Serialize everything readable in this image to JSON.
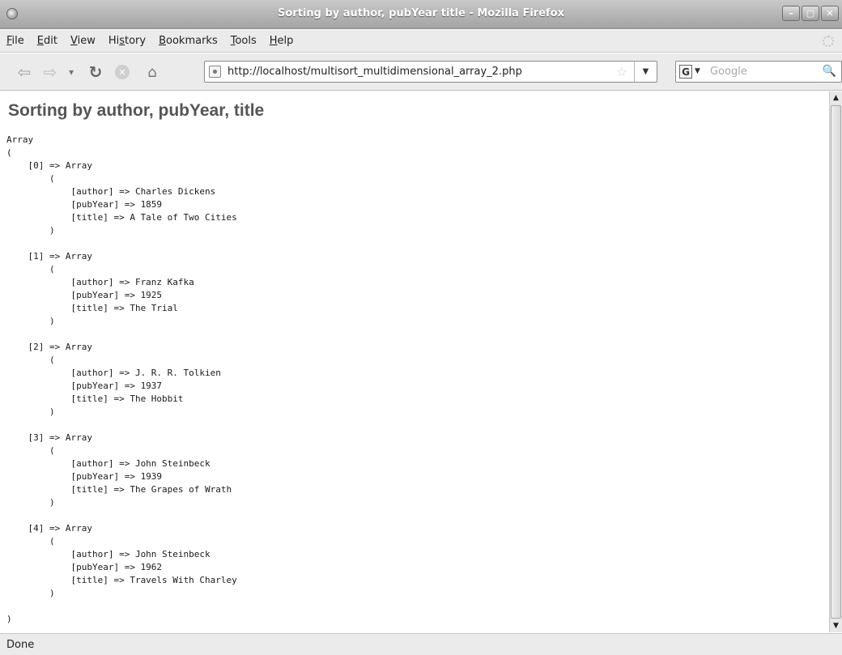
{
  "window": {
    "title": "Sorting by author, pubYear title - Mozilla Firefox",
    "buttons": {
      "minimize": "–",
      "maximize": "▢",
      "close": "✕"
    }
  },
  "menu": {
    "items": [
      {
        "label": "File",
        "accesskey": "F"
      },
      {
        "label": "Edit",
        "accesskey": "E"
      },
      {
        "label": "View",
        "accesskey": "V"
      },
      {
        "label": "History",
        "accesskey": "s"
      },
      {
        "label": "Bookmarks",
        "accesskey": "B"
      },
      {
        "label": "Tools",
        "accesskey": "T"
      },
      {
        "label": "Help",
        "accesskey": "H"
      }
    ]
  },
  "toolbar": {
    "url": "http://localhost/multisort_multidimensional_array_2.php",
    "search_engine_letter": "G",
    "search_placeholder": "Google",
    "icons": [
      "back-icon",
      "forward-icon",
      "history-dropdown-icon",
      "reload-icon",
      "stop-icon",
      "home-icon",
      "site-identity-icon",
      "bookmark-star-icon",
      "url-dropdown-icon",
      "search-engine-icon",
      "search-go-icon"
    ]
  },
  "page": {
    "heading": "Sorting by author, pubYear, title",
    "dump": "Array\n(\n    [0] => Array\n        (\n            [author] => Charles Dickens\n            [pubYear] => 1859\n            [title] => A Tale of Two Cities\n        )\n\n    [1] => Array\n        (\n            [author] => Franz Kafka\n            [pubYear] => 1925\n            [title] => The Trial\n        )\n\n    [2] => Array\n        (\n            [author] => J. R. R. Tolkien\n            [pubYear] => 1937\n            [title] => The Hobbit\n        )\n\n    [3] => Array\n        (\n            [author] => John Steinbeck\n            [pubYear] => 1939\n            [title] => The Grapes of Wrath\n        )\n\n    [4] => Array\n        (\n            [author] => John Steinbeck\n            [pubYear] => 1962\n            [title] => Travels With Charley\n        )\n\n)"
  },
  "status": {
    "text": "Done"
  }
}
